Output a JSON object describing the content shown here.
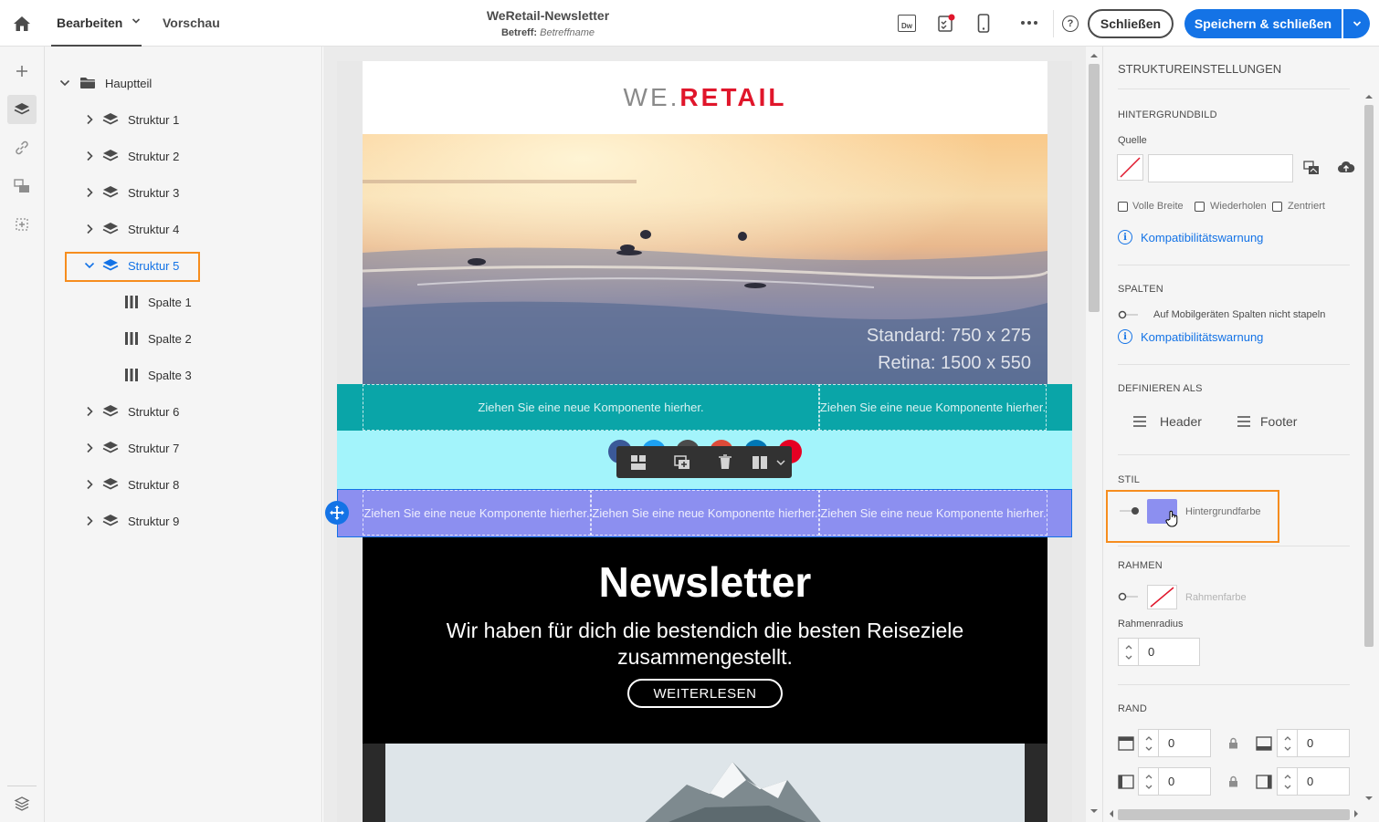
{
  "topbar": {
    "tab_edit": "Bearbeiten",
    "tab_preview": "Vorschau",
    "title": "WeRetail-Newsletter",
    "subject_label": "Betreff:",
    "subject_value": "Betreffname",
    "close_label": "Schließen",
    "save_label": "Speichern & schließen",
    "dw_label": "Dw"
  },
  "tree": {
    "root": "Hauptteil",
    "items": [
      {
        "label": "Struktur 1"
      },
      {
        "label": "Struktur 2"
      },
      {
        "label": "Struktur 3"
      },
      {
        "label": "Struktur 4"
      },
      {
        "label": "Struktur 5"
      },
      {
        "label": "Spalte 1"
      },
      {
        "label": "Spalte 2"
      },
      {
        "label": "Spalte 3"
      },
      {
        "label": "Struktur 6"
      },
      {
        "label": "Struktur 7"
      },
      {
        "label": "Struktur 8"
      },
      {
        "label": "Struktur 9"
      }
    ]
  },
  "canvas": {
    "logo_part1": "WE.",
    "logo_part2": "RETAIL",
    "hero_line1": "Standard: 750 x 275",
    "hero_line2": "Retina: 1500 x 550",
    "drop_text": "Ziehen Sie eine neue Komponente hierher.",
    "newsletter_title": "Newsletter",
    "newsletter_text_1": "Wir haben für dich die bestendich die besten Reiseziele",
    "newsletter_text_2": "zusammengestellt.",
    "cta_label": "WEITERLESEN"
  },
  "panel": {
    "title": "STRUKTUREINSTELLUNGEN",
    "bg_image_head": "HINTERGRUNDBILD",
    "source_label": "Quelle",
    "source_value": "",
    "cb_full_width": "Volle Breite",
    "cb_repeat": "Wiederholen",
    "cb_centered": "Zentriert",
    "compat_warning": "Kompatibilitätswarnung",
    "columns_head": "SPALTEN",
    "no_stack_label": "Auf Mobilgeräten Spalten nicht stapeln",
    "define_as_head": "DEFINIEREN ALS",
    "header_label": "Header",
    "footer_label": "Footer",
    "style_head": "STIL",
    "bg_color_label": "Hintergrundfarbe",
    "bg_color": "#8c8ff0",
    "border_head": "RAHMEN",
    "border_color_label": "Rahmenfarbe",
    "border_radius_label": "Rahmenradius",
    "border_radius_value": "0",
    "margin_head": "RAND",
    "margin_top": "0",
    "margin_bottom": "0",
    "margin_left": "0",
    "margin_right": "0"
  },
  "colors": {
    "accent": "#1473e6",
    "highlight": "#f68d1e",
    "teal_band": "#0aa5a8",
    "cyan_band": "#a3f4fb",
    "purple_band": "#8c8ff0",
    "logo_red": "#e0162b"
  }
}
